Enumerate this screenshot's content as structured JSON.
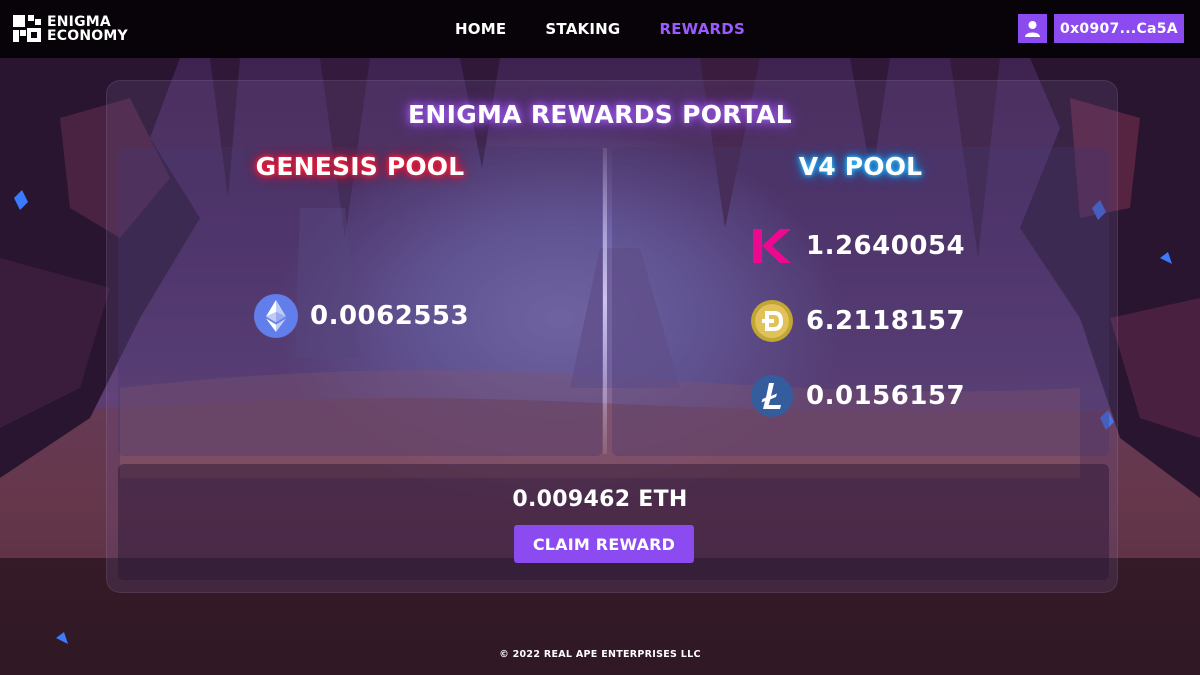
{
  "brand": {
    "line1": "ENIGMA",
    "line2": "ECONOMY",
    "logo_icon": "enigma-logo-icon"
  },
  "nav": [
    {
      "label": "HOME",
      "active": false
    },
    {
      "label": "STAKING",
      "active": false
    },
    {
      "label": "REWARDS",
      "active": true
    }
  ],
  "account": {
    "icon": "user-icon",
    "wallet": "0x0907...Ca5A"
  },
  "portal": {
    "title": "ENIGMA REWARDS PORTAL",
    "genesis": {
      "title": "GENESIS POOL",
      "rewards": [
        {
          "coin": "ETH",
          "icon": "ethereum-icon",
          "value": "0.0062553"
        }
      ]
    },
    "v4": {
      "title": "V4 POOL",
      "rewards": [
        {
          "coin": "KDA",
          "icon": "kadena-icon",
          "value": "1.2640054"
        },
        {
          "coin": "DOGE",
          "icon": "dogecoin-icon",
          "value": "6.2118157"
        },
        {
          "coin": "LTC",
          "icon": "litecoin-icon",
          "value": "0.0156157"
        }
      ]
    },
    "total": "0.009462 ETH",
    "claim_label": "CLAIM REWARD"
  },
  "footer": "© 2022 REAL APE ENTERPRISES LLC",
  "colors": {
    "accent": "#8c4bf0",
    "nav_active": "#9b5bff",
    "genesis_glow": "#ff1f3a",
    "v4_glow": "#1aa8ff",
    "header_bg": "#070308"
  }
}
